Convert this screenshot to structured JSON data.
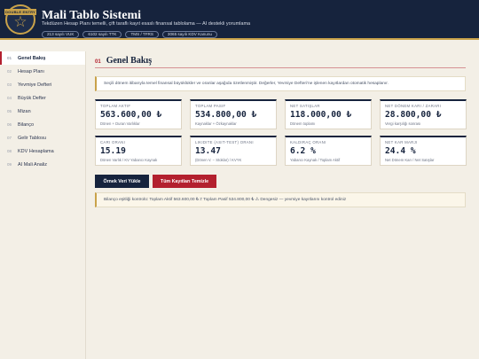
{
  "header": {
    "logo_text": "DOUBLE ENTRY",
    "logo_icon": "star-icon",
    "title": "Mali Tablo Sistemi",
    "subtitle": "Tekdüzen Hesap Planı temelli, çift taraflı kayıt esaslı finansal tablolama — AI destekli yorumlama",
    "badges": [
      "213 sayılı VUK",
      "6102 sayılı TTK",
      "TMS / TFRS",
      "3065 sayılı KDV Kanunu"
    ]
  },
  "sidebar": {
    "items": [
      {
        "num": "01",
        "label": "Genel Bakış",
        "active": true
      },
      {
        "num": "02",
        "label": "Hesap Planı"
      },
      {
        "num": "03",
        "label": "Yevmiye Defteri"
      },
      {
        "num": "04",
        "label": "Büyük Defter"
      },
      {
        "num": "05",
        "label": "Mizan"
      },
      {
        "num": "06",
        "label": "Bilanço"
      },
      {
        "num": "07",
        "label": "Gelir Tablosu"
      },
      {
        "num": "08",
        "label": "KDV Hesaplama"
      },
      {
        "num": "09",
        "label": "AI Mali Analiz"
      }
    ]
  },
  "main": {
    "section_num": "01",
    "section_title": "Genel Bakış",
    "info": "Seçili dönem itibarıyla temel finansal büyüklükler ve oranlar aşağıda özetlenmiştir. Değerler, Yevmiye Defteri'ne işlenen kayıtlardan otomatik hesaplanır.",
    "kpis": [
      {
        "label": "Toplam Aktif",
        "value": "563.600,00 ₺",
        "sub": "Dönen + Duran Varlıklar"
      },
      {
        "label": "Toplam Pasif",
        "value": "534.800,00 ₺",
        "sub": "Kaynaklar + Özkaynaklar"
      },
      {
        "label": "Net Satışlar",
        "value": "118.000,00 ₺",
        "sub": "Dönem toplamı"
      },
      {
        "label": "Net Dönem Karı / Zararı",
        "value": "28.800,00 ₺",
        "sub": "Vergi karşılığı sonrası"
      },
      {
        "label": "Cari Oranı",
        "value": "15.19",
        "sub": "Dönen Varlık / KV Yabancı Kaynak"
      },
      {
        "label": "Likidite (Asit-Test) Oranı",
        "value": "13.47",
        "sub": "(Dönen V. − Stoklar) / KVYK"
      },
      {
        "label": "Kaldıraç Oranı",
        "value": "6.2 %",
        "sub": "Yabancı Kaynak / Toplam Aktif"
      },
      {
        "label": "Net Kar Marjı",
        "value": "24.4 %",
        "sub": "Net Dönem Karı / Net Satışlar"
      }
    ],
    "buttons": {
      "load_sample": "Örnek Veri Yükle",
      "clear_all": "Tüm Kayıtları Temizle"
    },
    "balance_check": "Bilanço eşitliği kontrolü: Toplam Aktif 563.600,00 ₺ ≠ Toplam Pasif 534.800,00 ₺ ⚠ Dengesiz — yevmiye kayıtlarını kontrol ediniz"
  },
  "colors": {
    "navy": "#16233d",
    "accent_red": "#b3202e",
    "gold": "#c9a24a",
    "background": "#f3efe6"
  }
}
